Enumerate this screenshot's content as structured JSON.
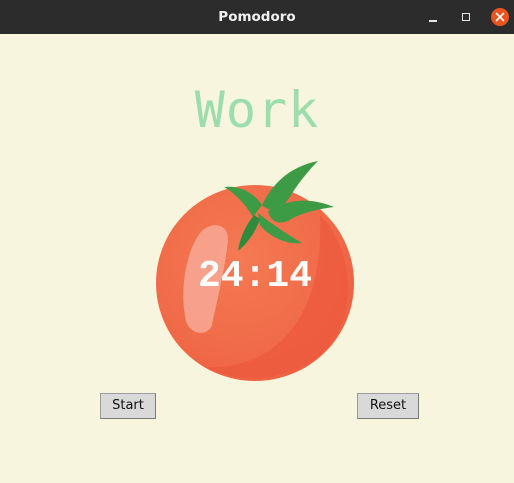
{
  "window": {
    "title": "Pomodoro",
    "controls": {
      "minimize_icon": "minimize-icon",
      "maximize_icon": "maximize-icon",
      "close_icon": "close-icon",
      "close_color": "#e95420"
    }
  },
  "app": {
    "mode_label": "Work",
    "mode_color": "#9bdeac",
    "timer": "24:14",
    "background_color": "#f7f5dd",
    "image_icon": "tomato-icon",
    "buttons": {
      "start_label": "Start",
      "reset_label": "Reset"
    }
  }
}
